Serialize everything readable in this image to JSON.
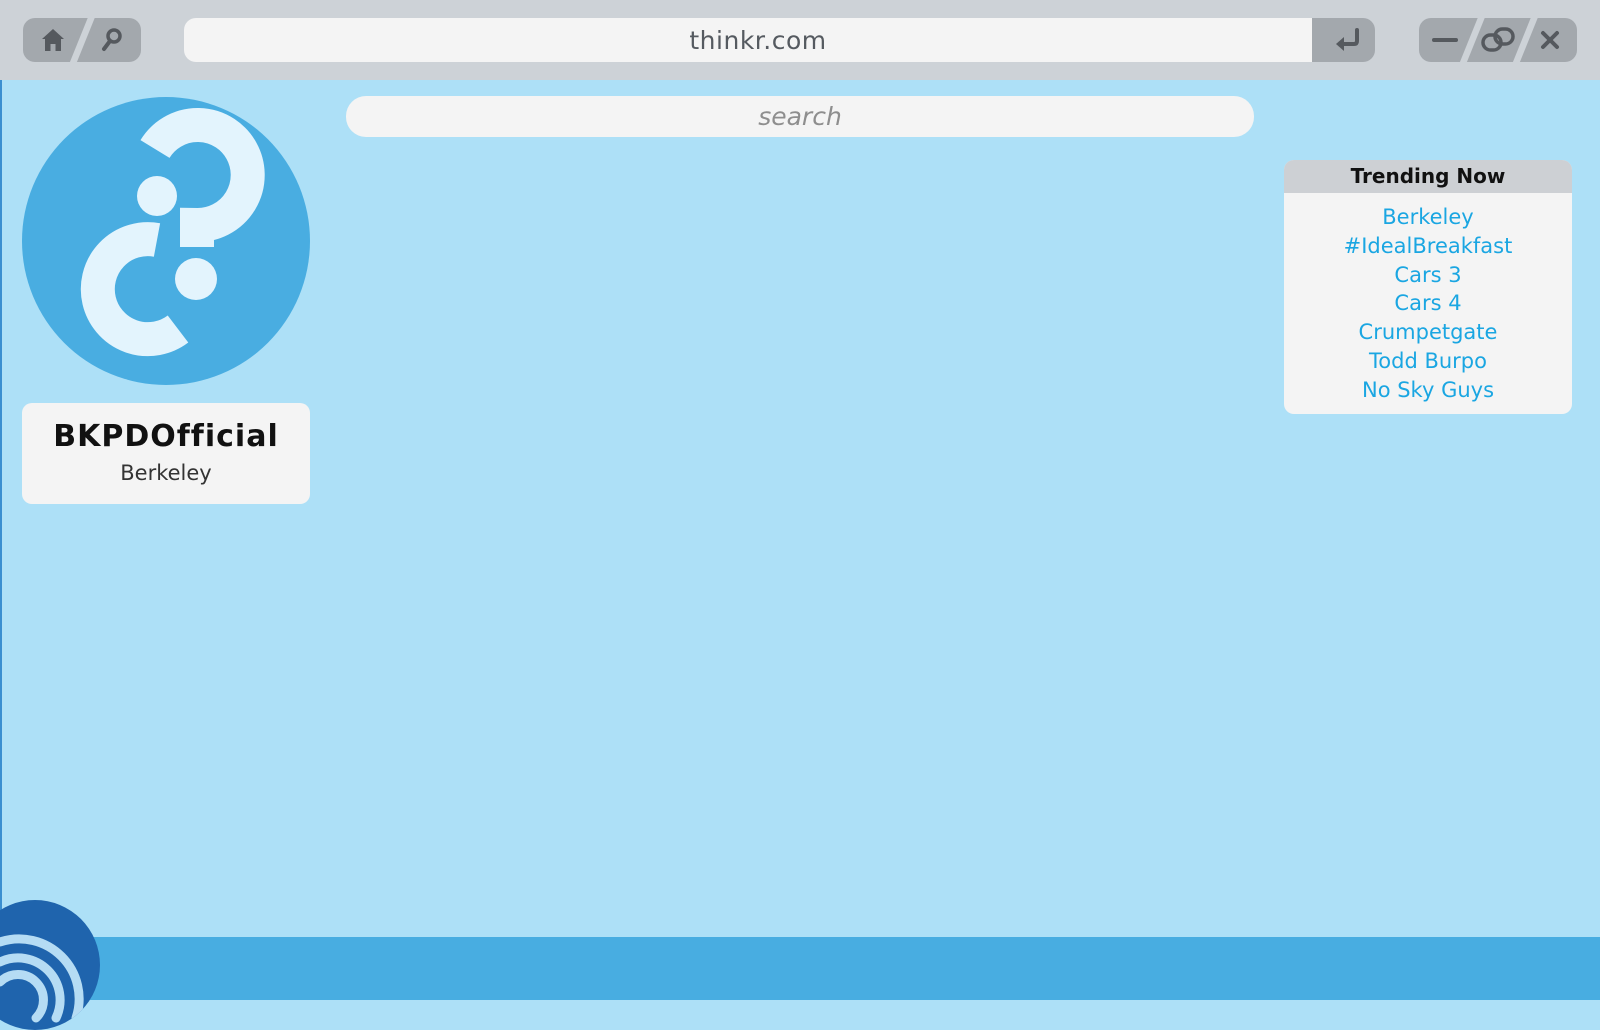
{
  "browser": {
    "url": "thinkr.com",
    "icons": {
      "home": "home-icon",
      "search": "magnifier-icon",
      "enter": "enter-arrow-icon",
      "minimize": "minimize-icon",
      "link": "link-icon",
      "close": "close-icon"
    }
  },
  "search": {
    "placeholder": "search"
  },
  "profile": {
    "avatar_icon": "question-mark-logo",
    "name": "BKPDOfficial",
    "location": "Berkeley"
  },
  "trending": {
    "title": "Trending Now",
    "items": [
      "Berkeley",
      "#IdealBreakfast",
      "Cars 3",
      "Cars 4",
      "Crumpetgate",
      "Todd Burpo",
      "No Sky Guys"
    ]
  },
  "footer": {
    "badge_icon": "feed-icon"
  },
  "colors": {
    "background": "#ade0f7",
    "chrome": "#cdd2d7",
    "accent": "#48ade1",
    "link": "#1aa6e2",
    "badge": "#1f64ad"
  }
}
